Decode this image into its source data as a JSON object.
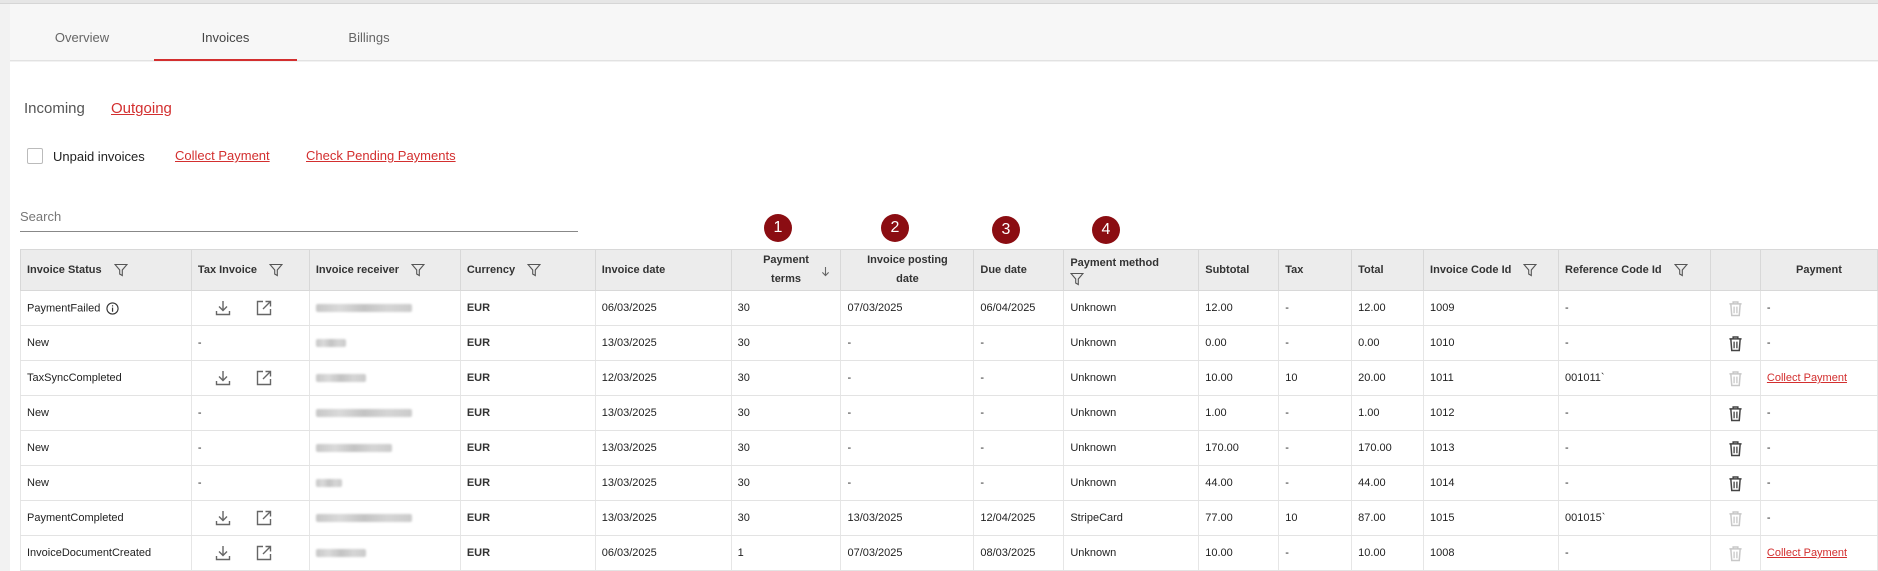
{
  "tabs": [
    {
      "label": "Overview"
    },
    {
      "label": "Invoices"
    },
    {
      "label": "Billings"
    }
  ],
  "subnav": {
    "incoming": "Incoming",
    "outgoing": "Outgoing"
  },
  "filters": {
    "unpaid_label": "Unpaid invoices",
    "collect_payment": "Collect Payment",
    "check_pending": "Check Pending Payments"
  },
  "search": {
    "placeholder": "Search",
    "value": ""
  },
  "markers": [
    "1",
    "2",
    "3",
    "4"
  ],
  "table": {
    "headers": {
      "status": "Invoice Status",
      "tax_invoice": "Tax Invoice",
      "receiver": "Invoice receiver",
      "currency": "Currency",
      "invoice_date": "Invoice date",
      "payment_terms_1": "Payment",
      "payment_terms_2": "terms",
      "posting_1": "Invoice posting",
      "posting_2": "date",
      "due_date": "Due date",
      "method": "Payment method",
      "subtotal": "Subtotal",
      "tax": "Tax",
      "total": "Total",
      "code_id": "Invoice Code Id",
      "ref_id": "Reference Code Id",
      "payment": "Payment"
    },
    "rows": [
      {
        "status": "PaymentFailed",
        "info": true,
        "tax_icons": true,
        "tax_text": "",
        "receiver_w": 96,
        "currency": "EUR",
        "invoice_date": "06/03/2025",
        "terms": "30",
        "posting": "07/03/2025",
        "due": "06/04/2025",
        "method": "Unknown",
        "subtotal": "12.00",
        "tax": "-",
        "total": "12.00",
        "code": "1009",
        "ref": "-",
        "delete_enabled": false,
        "payment": "-",
        "payment_link": false
      },
      {
        "status": "New",
        "info": false,
        "tax_icons": false,
        "tax_text": "-",
        "receiver_w": 30,
        "currency": "EUR",
        "invoice_date": "13/03/2025",
        "terms": "30",
        "posting": "-",
        "due": "-",
        "method": "Unknown",
        "subtotal": "0.00",
        "tax": "-",
        "total": "0.00",
        "code": "1010",
        "ref": "-",
        "delete_enabled": true,
        "payment": "-",
        "payment_link": false
      },
      {
        "status": "TaxSyncCompleted",
        "info": false,
        "tax_icons": true,
        "tax_text": "",
        "receiver_w": 50,
        "currency": "EUR",
        "invoice_date": "12/03/2025",
        "terms": "30",
        "posting": "-",
        "due": "-",
        "method": "Unknown",
        "subtotal": "10.00",
        "tax": "10",
        "total": "20.00",
        "code": "1011",
        "ref": "001011`",
        "delete_enabled": false,
        "payment": "Collect Payment",
        "payment_link": true
      },
      {
        "status": "New",
        "info": false,
        "tax_icons": false,
        "tax_text": "-",
        "receiver_w": 96,
        "currency": "EUR",
        "invoice_date": "13/03/2025",
        "terms": "30",
        "posting": "-",
        "due": "-",
        "method": "Unknown",
        "subtotal": "1.00",
        "tax": "-",
        "total": "1.00",
        "code": "1012",
        "ref": "-",
        "delete_enabled": true,
        "payment": "-",
        "payment_link": false
      },
      {
        "status": "New",
        "info": false,
        "tax_icons": false,
        "tax_text": "-",
        "receiver_w": 76,
        "currency": "EUR",
        "invoice_date": "13/03/2025",
        "terms": "30",
        "posting": "-",
        "due": "-",
        "method": "Unknown",
        "subtotal": "170.00",
        "tax": "-",
        "total": "170.00",
        "code": "1013",
        "ref": "-",
        "delete_enabled": true,
        "payment": "-",
        "payment_link": false
      },
      {
        "status": "New",
        "info": false,
        "tax_icons": false,
        "tax_text": "-",
        "receiver_w": 26,
        "currency": "EUR",
        "invoice_date": "13/03/2025",
        "terms": "30",
        "posting": "-",
        "due": "-",
        "method": "Unknown",
        "subtotal": "44.00",
        "tax": "-",
        "total": "44.00",
        "code": "1014",
        "ref": "-",
        "delete_enabled": true,
        "payment": "-",
        "payment_link": false
      },
      {
        "status": "PaymentCompleted",
        "info": false,
        "tax_icons": true,
        "tax_text": "",
        "receiver_w": 96,
        "currency": "EUR",
        "invoice_date": "13/03/2025",
        "terms": "30",
        "posting": "13/03/2025",
        "due": "12/04/2025",
        "method": "StripeCard",
        "subtotal": "77.00",
        "tax": "10",
        "total": "87.00",
        "code": "1015",
        "ref": "001015`",
        "delete_enabled": false,
        "payment": "-",
        "payment_link": false
      },
      {
        "status": "InvoiceDocumentCreated",
        "info": false,
        "tax_icons": true,
        "tax_text": "",
        "receiver_w": 50,
        "currency": "EUR",
        "invoice_date": "06/03/2025",
        "terms": "1",
        "posting": "07/03/2025",
        "due": "08/03/2025",
        "method": "Unknown",
        "subtotal": "10.00",
        "tax": "-",
        "total": "10.00",
        "code": "1008",
        "ref": "-",
        "delete_enabled": false,
        "payment": "Collect Payment",
        "payment_link": true
      }
    ]
  }
}
